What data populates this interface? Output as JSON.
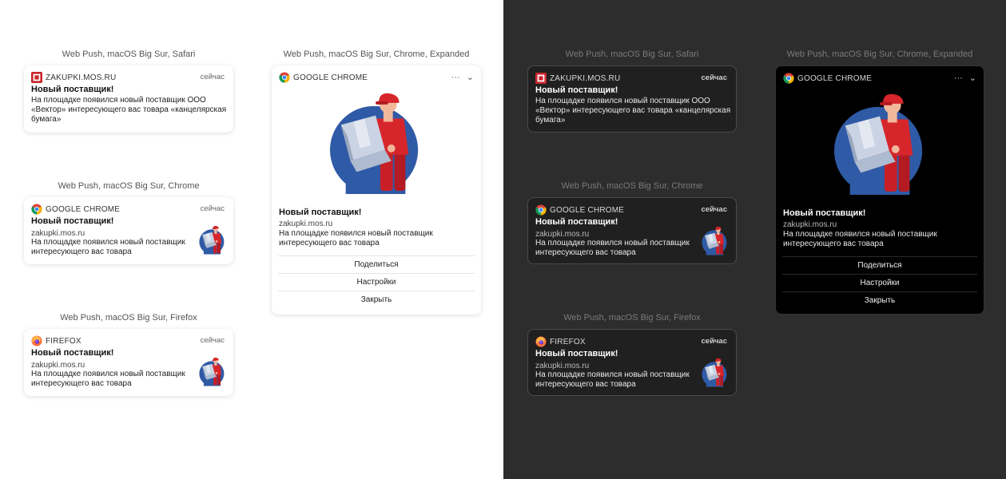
{
  "captions": {
    "safari": "Web Push, macOS Big Sur, Safari",
    "chrome": "Web Push, macOS Big Sur, Chrome",
    "firefox": "Web Push, macOS Big Sur, Firefox",
    "chrome_expanded": "Web Push, macOS Big Sur, Chrome, Expanded"
  },
  "apps": {
    "safari": "ZAKUPKI.MOS.RU",
    "chrome": "GOOGLE CHROME",
    "firefox": "FIREFOX"
  },
  "time": "сейчас",
  "notification": {
    "title": "Новый поставщик!",
    "source": "zakupki.mos.ru",
    "safari_body": "На площадке появился новый поставщик ООО «Вектор» интересующего вас товара «канцелярская бумага»",
    "body": "На площадке появился новый поставщик интересующего вас товара"
  },
  "actions": {
    "share": "Поделиться",
    "settings": "Настройки",
    "close": "Закрыть"
  },
  "controls": {
    "more": "···",
    "chevron": "⌄"
  },
  "colors": {
    "light_bg": "#ffffff",
    "dark_bg": "#2d2d2d",
    "avatar_blue": "#2f5aa6",
    "courier_red": "#d7262b",
    "safari_icon_red": "#c9252c"
  }
}
